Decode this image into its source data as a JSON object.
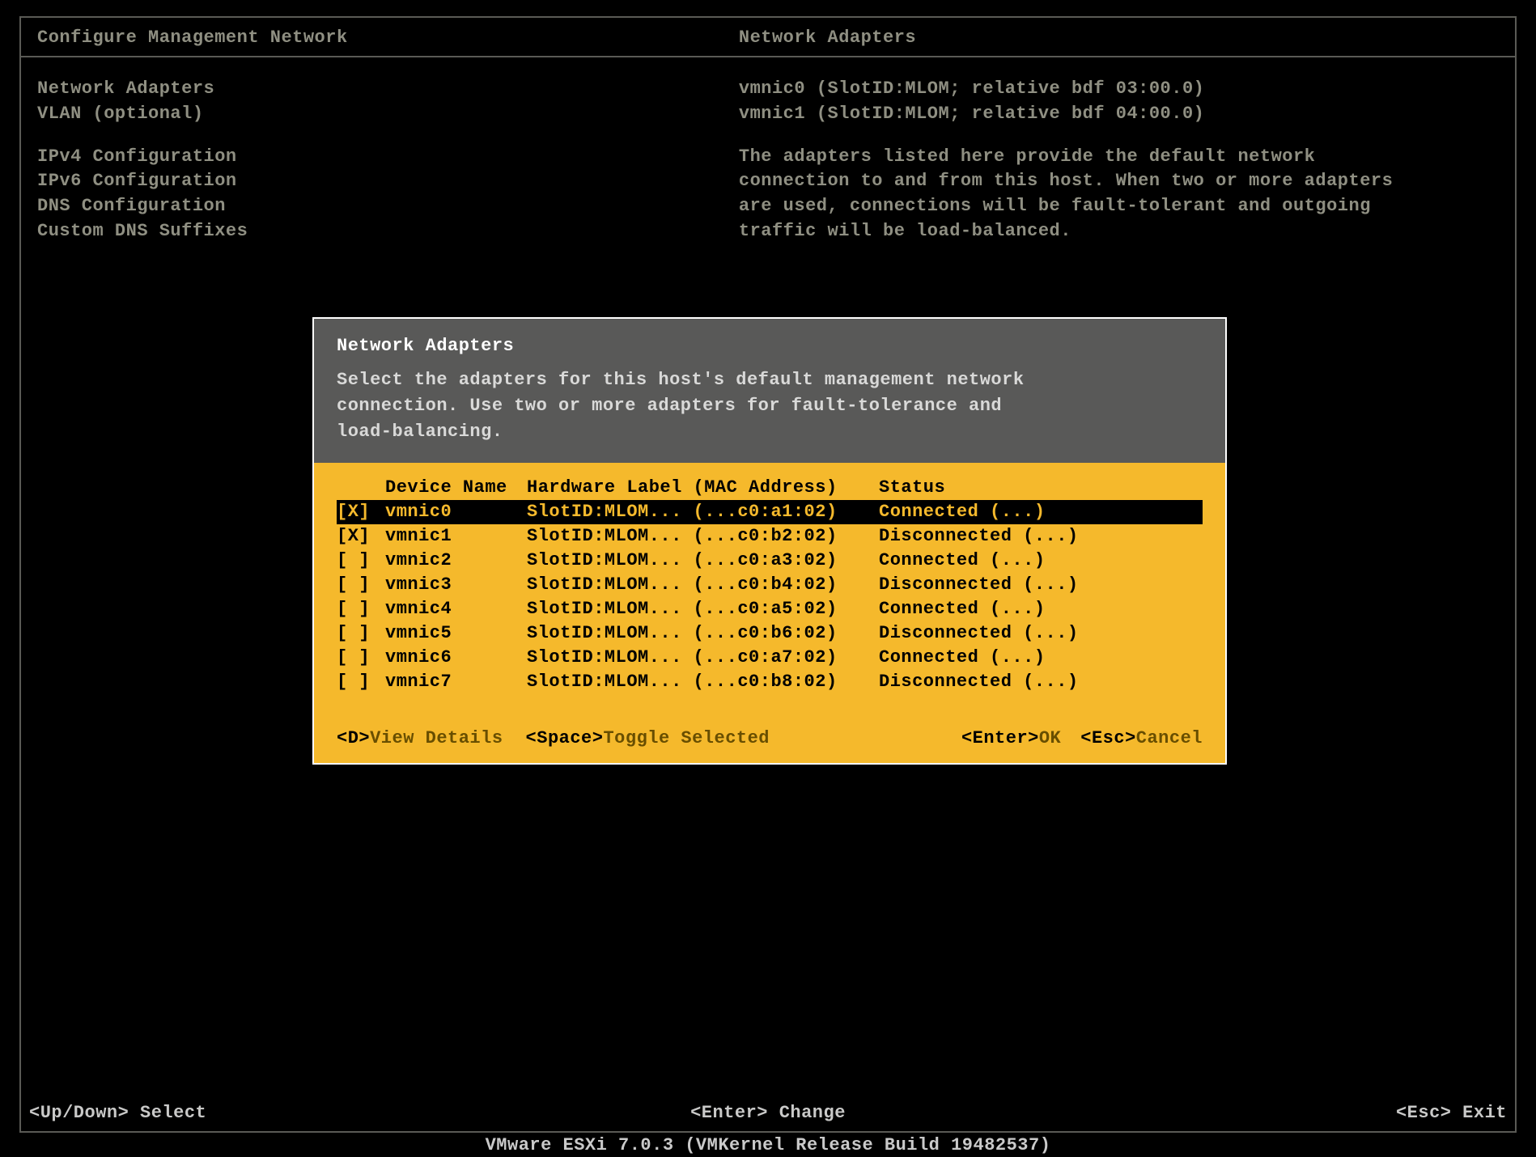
{
  "header": {
    "left_title": "Configure Management Network",
    "right_title": "Network Adapters"
  },
  "left_menu": {
    "group1": [
      "Network Adapters",
      "VLAN (optional)"
    ],
    "group2": [
      "IPv4 Configuration",
      "IPv6 Configuration",
      "DNS Configuration",
      "Custom DNS Suffixes"
    ]
  },
  "right_panel": {
    "lines1": [
      "vmnic0 (SlotID:MLOM; relative bdf 03:00.0)",
      "vmnic1 (SlotID:MLOM; relative bdf 04:00.0)"
    ],
    "desc": [
      "The adapters listed here provide the default network",
      "connection to and from this host. When two or more adapters",
      "are used, connections will be fault-tolerant and outgoing",
      "traffic will be load-balanced."
    ]
  },
  "dialog": {
    "title": "Network Adapters",
    "instructions": [
      "Select the adapters for this host's default management network",
      "connection. Use two or more adapters for fault-tolerance and",
      "load-balancing."
    ],
    "columns": {
      "name": "Device Name",
      "hw": "Hardware Label (MAC Address)",
      "status": "Status"
    },
    "rows": [
      {
        "checked": "[X]",
        "name": "vmnic0",
        "hw": "SlotID:MLOM... (...c0:a1:02)",
        "status": "Connected (...)",
        "selected": true
      },
      {
        "checked": "[X]",
        "name": "vmnic1",
        "hw": "SlotID:MLOM... (...c0:b2:02)",
        "status": "Disconnected (...)",
        "selected": false
      },
      {
        "checked": "[ ]",
        "name": "vmnic2",
        "hw": "SlotID:MLOM... (...c0:a3:02)",
        "status": "Connected (...)",
        "selected": false
      },
      {
        "checked": "[ ]",
        "name": "vmnic3",
        "hw": "SlotID:MLOM... (...c0:b4:02)",
        "status": "Disconnected (...)",
        "selected": false
      },
      {
        "checked": "[ ]",
        "name": "vmnic4",
        "hw": "SlotID:MLOM... (...c0:a5:02)",
        "status": "Connected (...)",
        "selected": false
      },
      {
        "checked": "[ ]",
        "name": "vmnic5",
        "hw": "SlotID:MLOM... (...c0:b6:02)",
        "status": "Disconnected (...)",
        "selected": false
      },
      {
        "checked": "[ ]",
        "name": "vmnic6",
        "hw": "SlotID:MLOM... (...c0:a7:02)",
        "status": "Connected (...)",
        "selected": false
      },
      {
        "checked": "[ ]",
        "name": "vmnic7",
        "hw": "SlotID:MLOM... (...c0:b8:02)",
        "status": "Disconnected (...)",
        "selected": false
      }
    ],
    "hints": {
      "d_key": "<D>",
      "d_txt": " View Details",
      "space_key": "<Space>",
      "space_txt": " Toggle Selected",
      "enter_key": "<Enter>",
      "enter_txt": " OK",
      "esc_key": "<Esc>",
      "esc_txt": " Cancel"
    }
  },
  "bottom": {
    "left": "<Up/Down> Select",
    "center": "<Enter> Change",
    "right": "<Esc> Exit"
  },
  "footer": "VMware ESXi 7.0.3 (VMKernel Release Build 19482537)"
}
